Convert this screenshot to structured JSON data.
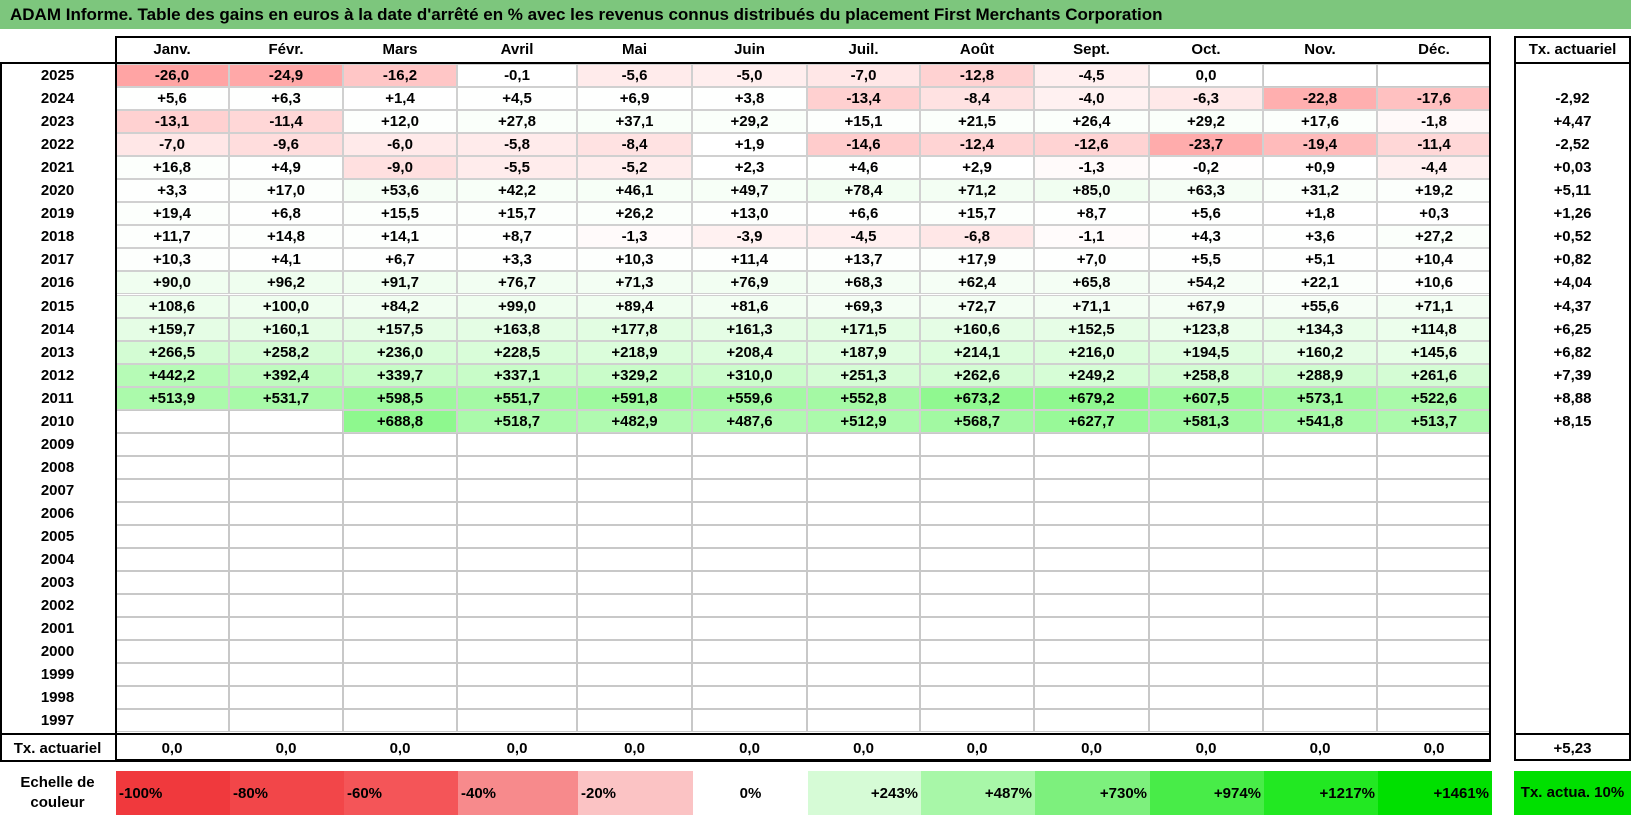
{
  "title": "ADAM Informe. Table des gains en euros à la date d'arrêté en % avec les revenus connus distribués du placement First Merchants Corporation",
  "months": [
    "Janv.",
    "Févr.",
    "Mars",
    "Avril",
    "Mai",
    "Juin",
    "Juil.",
    "Août",
    "Sept.",
    "Oct.",
    "Nov.",
    "Déc."
  ],
  "rate_header": "Tx. actuariel",
  "rows": [
    {
      "year": "2025",
      "values": [
        "-26,0",
        "-24,9",
        "-16,2",
        "-0,1",
        "-5,6",
        "-5,0",
        "-7,0",
        "-12,8",
        "-4,5",
        "0,0",
        "",
        ""
      ],
      "rate": ""
    },
    {
      "year": "2024",
      "values": [
        "+5,6",
        "+6,3",
        "+1,4",
        "+4,5",
        "+6,9",
        "+3,8",
        "-13,4",
        "-8,4",
        "-4,0",
        "-6,3",
        "-22,8",
        "-17,6"
      ],
      "rate": "-2,92"
    },
    {
      "year": "2023",
      "values": [
        "-13,1",
        "-11,4",
        "+12,0",
        "+27,8",
        "+37,1",
        "+29,2",
        "+15,1",
        "+21,5",
        "+26,4",
        "+29,2",
        "+17,6",
        "-1,8"
      ],
      "rate": "+4,47"
    },
    {
      "year": "2022",
      "values": [
        "-7,0",
        "-9,6",
        "-6,0",
        "-5,8",
        "-8,4",
        "+1,9",
        "-14,6",
        "-12,4",
        "-12,6",
        "-23,7",
        "-19,4",
        "-11,4"
      ],
      "rate": "-2,52"
    },
    {
      "year": "2021",
      "values": [
        "+16,8",
        "+4,9",
        "-9,0",
        "-5,5",
        "-5,2",
        "+2,3",
        "+4,6",
        "+2,9",
        "-1,3",
        "-0,2",
        "+0,9",
        "-4,4"
      ],
      "rate": "+0,03"
    },
    {
      "year": "2020",
      "values": [
        "+3,3",
        "+17,0",
        "+53,6",
        "+42,2",
        "+46,1",
        "+49,7",
        "+78,4",
        "+71,2",
        "+85,0",
        "+63,3",
        "+31,2",
        "+19,2"
      ],
      "rate": "+5,11"
    },
    {
      "year": "2019",
      "values": [
        "+19,4",
        "+6,8",
        "+15,5",
        "+15,7",
        "+26,2",
        "+13,0",
        "+6,6",
        "+15,7",
        "+8,7",
        "+5,6",
        "+1,8",
        "+0,3"
      ],
      "rate": "+1,26"
    },
    {
      "year": "2018",
      "values": [
        "+11,7",
        "+14,8",
        "+14,1",
        "+8,7",
        "-1,3",
        "-3,9",
        "-4,5",
        "-6,8",
        "-1,1",
        "+4,3",
        "+3,6",
        "+27,2"
      ],
      "rate": "+0,52"
    },
    {
      "year": "2017",
      "values": [
        "+10,3",
        "+4,1",
        "+6,7",
        "+3,3",
        "+10,3",
        "+11,4",
        "+13,7",
        "+17,9",
        "+7,0",
        "+5,5",
        "+5,1",
        "+10,4"
      ],
      "rate": "+0,82"
    },
    {
      "year": "2016",
      "values": [
        "+90,0",
        "+96,2",
        "+91,7",
        "+76,7",
        "+71,3",
        "+76,9",
        "+68,3",
        "+62,4",
        "+65,8",
        "+54,2",
        "+22,1",
        "+10,6"
      ],
      "rate": "+4,04"
    },
    {
      "year": "2015",
      "values": [
        "+108,6",
        "+100,0",
        "+84,2",
        "+99,0",
        "+89,4",
        "+81,6",
        "+69,3",
        "+72,7",
        "+71,1",
        "+67,9",
        "+55,6",
        "+71,1"
      ],
      "rate": "+4,37"
    },
    {
      "year": "2014",
      "values": [
        "+159,7",
        "+160,1",
        "+157,5",
        "+163,8",
        "+177,8",
        "+161,3",
        "+171,5",
        "+160,6",
        "+152,5",
        "+123,8",
        "+134,3",
        "+114,8"
      ],
      "rate": "+6,25"
    },
    {
      "year": "2013",
      "values": [
        "+266,5",
        "+258,2",
        "+236,0",
        "+228,5",
        "+218,9",
        "+208,4",
        "+187,9",
        "+214,1",
        "+216,0",
        "+194,5",
        "+160,2",
        "+145,6"
      ],
      "rate": "+6,82"
    },
    {
      "year": "2012",
      "values": [
        "+442,2",
        "+392,4",
        "+339,7",
        "+337,1",
        "+329,2",
        "+310,0",
        "+251,3",
        "+262,6",
        "+249,2",
        "+258,8",
        "+288,9",
        "+261,6"
      ],
      "rate": "+7,39"
    },
    {
      "year": "2011",
      "values": [
        "+513,9",
        "+531,7",
        "+598,5",
        "+551,7",
        "+591,8",
        "+559,6",
        "+552,8",
        "+673,2",
        "+679,2",
        "+607,5",
        "+573,1",
        "+522,6"
      ],
      "rate": "+8,88"
    },
    {
      "year": "2010",
      "values": [
        "",
        "",
        "+688,8",
        "+518,7",
        "+482,9",
        "+487,6",
        "+512,9",
        "+568,7",
        "+627,7",
        "+581,3",
        "+541,8",
        "+513,7"
      ],
      "rate": "+8,15"
    },
    {
      "year": "2009",
      "values": [
        "",
        "",
        "",
        "",
        "",
        "",
        "",
        "",
        "",
        "",
        "",
        ""
      ],
      "rate": ""
    },
    {
      "year": "2008",
      "values": [
        "",
        "",
        "",
        "",
        "",
        "",
        "",
        "",
        "",
        "",
        "",
        ""
      ],
      "rate": ""
    },
    {
      "year": "2007",
      "values": [
        "",
        "",
        "",
        "",
        "",
        "",
        "",
        "",
        "",
        "",
        "",
        ""
      ],
      "rate": ""
    },
    {
      "year": "2006",
      "values": [
        "",
        "",
        "",
        "",
        "",
        "",
        "",
        "",
        "",
        "",
        "",
        ""
      ],
      "rate": ""
    },
    {
      "year": "2005",
      "values": [
        "",
        "",
        "",
        "",
        "",
        "",
        "",
        "",
        "",
        "",
        "",
        ""
      ],
      "rate": ""
    },
    {
      "year": "2004",
      "values": [
        "",
        "",
        "",
        "",
        "",
        "",
        "",
        "",
        "",
        "",
        "",
        ""
      ],
      "rate": ""
    },
    {
      "year": "2003",
      "values": [
        "",
        "",
        "",
        "",
        "",
        "",
        "",
        "",
        "",
        "",
        "",
        ""
      ],
      "rate": ""
    },
    {
      "year": "2002",
      "values": [
        "",
        "",
        "",
        "",
        "",
        "",
        "",
        "",
        "",
        "",
        "",
        ""
      ],
      "rate": ""
    },
    {
      "year": "2001",
      "values": [
        "",
        "",
        "",
        "",
        "",
        "",
        "",
        "",
        "",
        "",
        "",
        ""
      ],
      "rate": ""
    },
    {
      "year": "2000",
      "values": [
        "",
        "",
        "",
        "",
        "",
        "",
        "",
        "",
        "",
        "",
        "",
        ""
      ],
      "rate": ""
    },
    {
      "year": "1999",
      "values": [
        "",
        "",
        "",
        "",
        "",
        "",
        "",
        "",
        "",
        "",
        "",
        ""
      ],
      "rate": ""
    },
    {
      "year": "1998",
      "values": [
        "",
        "",
        "",
        "",
        "",
        "",
        "",
        "",
        "",
        "",
        "",
        ""
      ],
      "rate": ""
    },
    {
      "year": "1997",
      "values": [
        "",
        "",
        "",
        "",
        "",
        "",
        "",
        "",
        "",
        "",
        "",
        ""
      ],
      "rate": ""
    }
  ],
  "footer": {
    "label": "Tx. actuariel",
    "values": [
      "0,0",
      "0,0",
      "0,0",
      "0,0",
      "0,0",
      "0,0",
      "0,0",
      "0,0",
      "0,0",
      "0,0",
      "0,0",
      "0,0"
    ],
    "rate": "+5,23"
  },
  "legend": {
    "label": "Echelle de couleur",
    "items": [
      {
        "text": "-100%",
        "color": "#f0393d"
      },
      {
        "text": "-80%",
        "color": "#f24649"
      },
      {
        "text": "-60%",
        "color": "#f45558"
      },
      {
        "text": "-40%",
        "color": "#f78a8c"
      },
      {
        "text": "-20%",
        "color": "#fbc3c4"
      },
      {
        "text": "0%",
        "color": "#ffffff"
      },
      {
        "text": "+243%",
        "color": "#d6fbd6"
      },
      {
        "text": "+487%",
        "color": "#a8f7a8"
      },
      {
        "text": "+730%",
        "color": "#7df07d"
      },
      {
        "text": "+974%",
        "color": "#48ec48"
      },
      {
        "text": "+1217%",
        "color": "#22e822"
      },
      {
        "text": "+1461%",
        "color": "#00e000"
      }
    ],
    "rate_label": "Tx. actua. 10%",
    "rate_color": "#00e000"
  }
}
